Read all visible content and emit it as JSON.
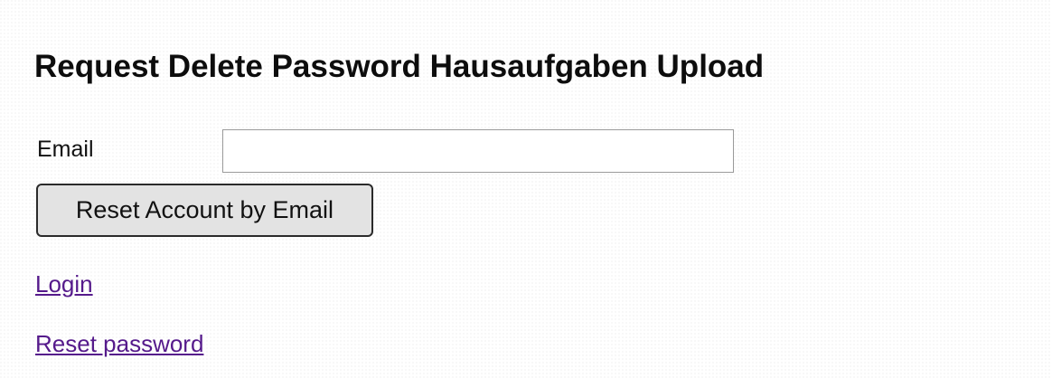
{
  "page": {
    "title": "Request Delete Password Hausaufgaben Upload"
  },
  "form": {
    "email_label": "Email",
    "email_value": "",
    "email_placeholder": "",
    "submit_label": "Reset Account by Email"
  },
  "links": {
    "login": "Login",
    "reset_password": "Reset password"
  },
  "colors": {
    "link": "#551a8b",
    "button_background": "#e3e3e3",
    "button_border": "#2b2b2b"
  }
}
